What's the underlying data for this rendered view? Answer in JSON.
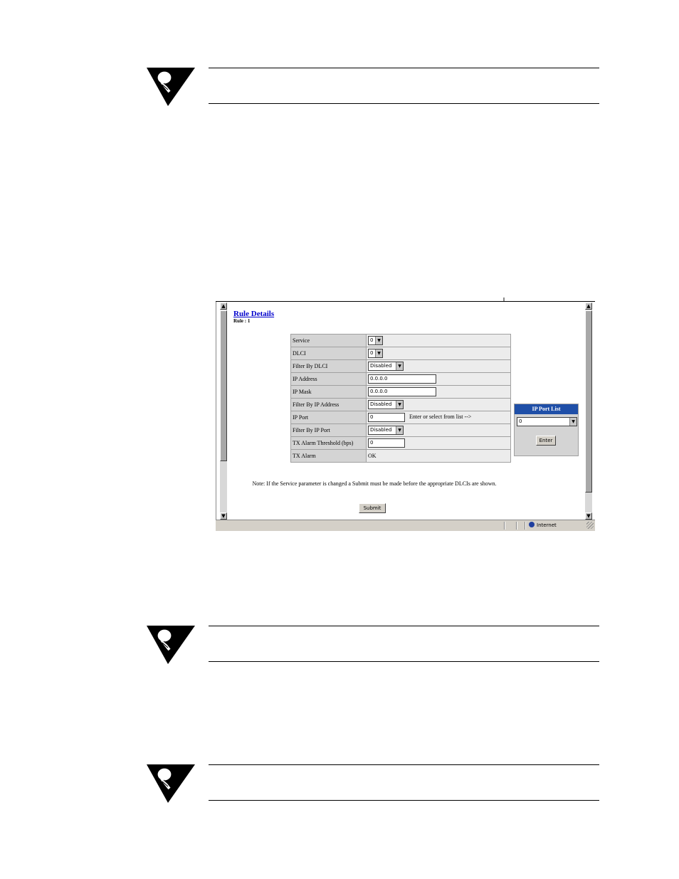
{
  "note_blocks": [
    {
      "id": "top"
    },
    {
      "id": "middle"
    },
    {
      "id": "bottom"
    }
  ],
  "screenshot": {
    "title": "Rule Details",
    "subtitle": "Rule : 1",
    "rows": [
      {
        "label": "Service",
        "kind": "select",
        "value": "0"
      },
      {
        "label": "DLCI",
        "kind": "select",
        "value": "0"
      },
      {
        "label": "Filter By DLCI",
        "kind": "select",
        "value": "Disabled"
      },
      {
        "label": "IP Address",
        "kind": "input",
        "value": "0.0.0.0"
      },
      {
        "label": "IP Mask",
        "kind": "input",
        "value": "0.0.0.0"
      },
      {
        "label": "Filter By IP Address",
        "kind": "select",
        "value": "Disabled"
      },
      {
        "label": "IP Port",
        "kind": "input",
        "value": "0",
        "hint": "Enter or select from list -->"
      },
      {
        "label": "Filter By IP Port",
        "kind": "select",
        "value": "Disabled"
      },
      {
        "label": "TX Alarm Threshold (bps)",
        "kind": "input",
        "value": "0"
      },
      {
        "label": "TX Alarm",
        "kind": "text",
        "value": "OK"
      }
    ],
    "port_list": {
      "title": "IP Port List",
      "selected": "0",
      "enter_label": "Enter"
    },
    "note": "Note:  If the Service parameter is changed a Submit must be made before the appropriate DLCIs are shown.",
    "submit_label": "Submit",
    "status_zone": "Internet"
  }
}
